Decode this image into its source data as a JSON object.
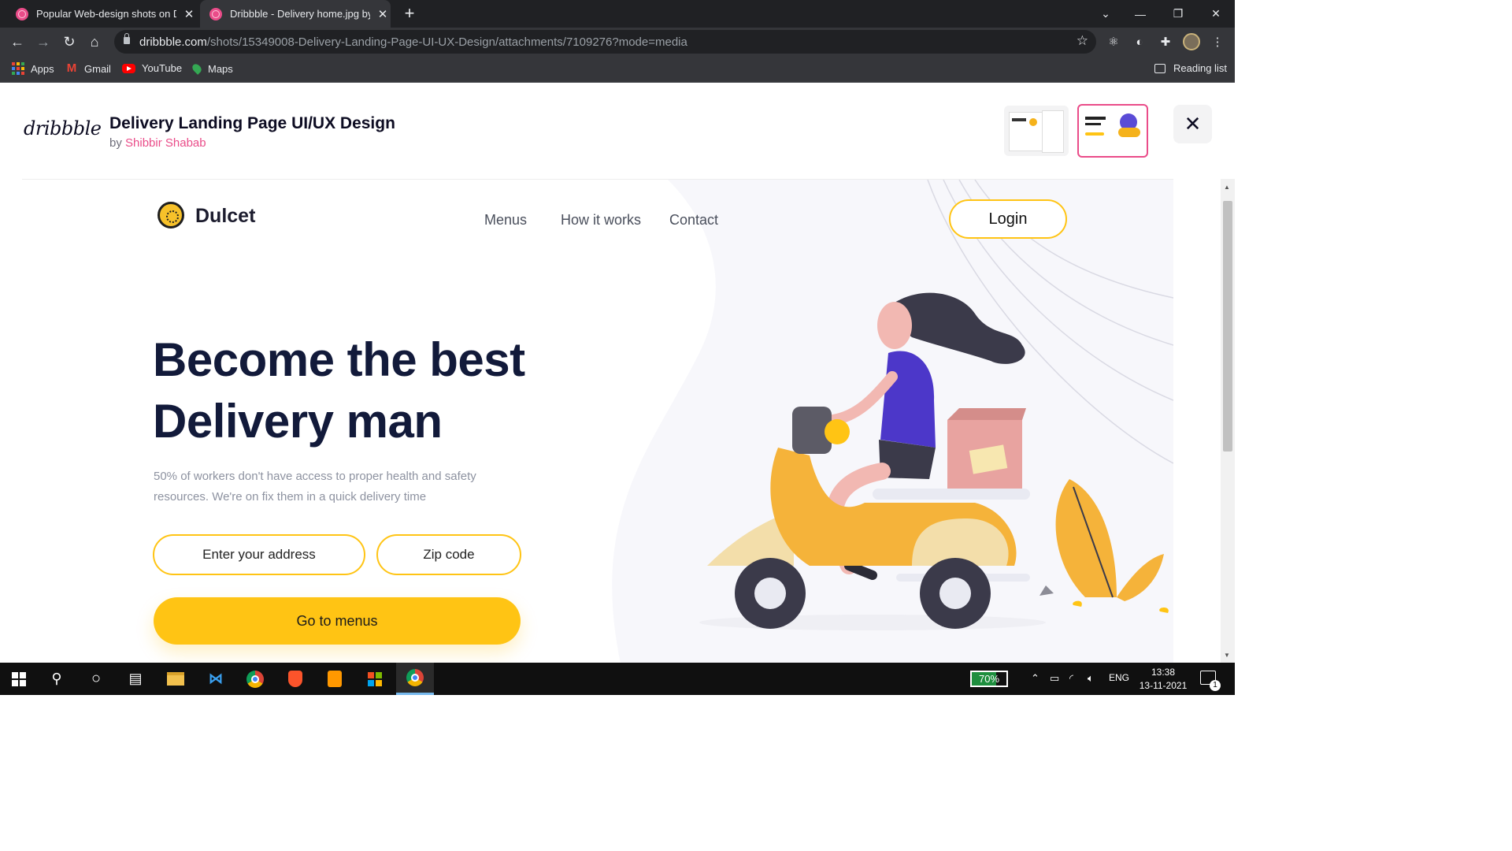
{
  "browser": {
    "tabs": [
      {
        "title": "Popular Web-design shots on Dr",
        "active": false
      },
      {
        "title": "Dribbble - Delivery home.jpg by S",
        "active": true
      }
    ],
    "url_host": "dribbble.com",
    "url_path": "/shots/15349008-Delivery-Landing-Page-UI-UX-Design/attachments/7109276?mode=media",
    "bookmarks": [
      "Apps",
      "Gmail",
      "YouTube",
      "Maps"
    ],
    "reading_list": "Reading list"
  },
  "dribbble": {
    "logo": "dribbble",
    "shot_title": "Delivery Landing Page UI/UX Design",
    "by_prefix": "by",
    "author": "Shibbir Shabab",
    "accent": "#ea4c89"
  },
  "shot": {
    "brand": "Dulcet",
    "nav": [
      "Menus",
      "How it works",
      "Contact"
    ],
    "login": "Login",
    "headline_line1": "Become the best",
    "headline_line2": "Delivery man",
    "subtext": "50% of workers don't have access to proper health and  safety resources. We're on fix them in a quick delivery time",
    "address_placeholder": "Enter your address",
    "zip_placeholder": "Zip code",
    "cta": "Go to menus",
    "accent": "#ffc414"
  },
  "taskbar": {
    "battery": "70%",
    "battery_level": 0.7,
    "language": "ENG",
    "time": "13:38",
    "date": "13-11-2021",
    "notification_count": "1"
  }
}
